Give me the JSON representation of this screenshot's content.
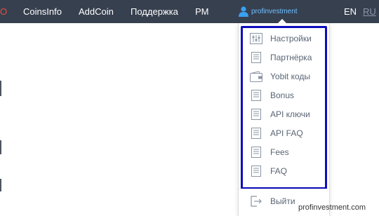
{
  "nav": {
    "cut_item": "O",
    "items": [
      "CoinsInfo",
      "AddCoin",
      "Поддержка",
      "PM"
    ],
    "username": "profinvestment",
    "languages": [
      "EN",
      "RU"
    ]
  },
  "user_menu": {
    "items": [
      {
        "label": "Настройки",
        "icon": "settings-icon"
      },
      {
        "label": "Партнёрка",
        "icon": "document-icon"
      },
      {
        "label": "Yobit коды",
        "icon": "wallet-icon"
      },
      {
        "label": "Bonus",
        "icon": "document-icon"
      },
      {
        "label": "API ключи",
        "icon": "document-icon"
      },
      {
        "label": "API FAQ",
        "icon": "document-icon"
      },
      {
        "label": "Fees",
        "icon": "document-icon"
      },
      {
        "label": "FAQ",
        "icon": "document-icon"
      }
    ],
    "logout": {
      "label": "Выйти",
      "icon": "logout-icon"
    }
  },
  "watermark": "profinvestment.com",
  "colors": {
    "nav_bg": "#37404f",
    "highlight": "#0d0dbd",
    "accent_blue": "#3aa0f0",
    "cut_red": "#e84c3d"
  }
}
